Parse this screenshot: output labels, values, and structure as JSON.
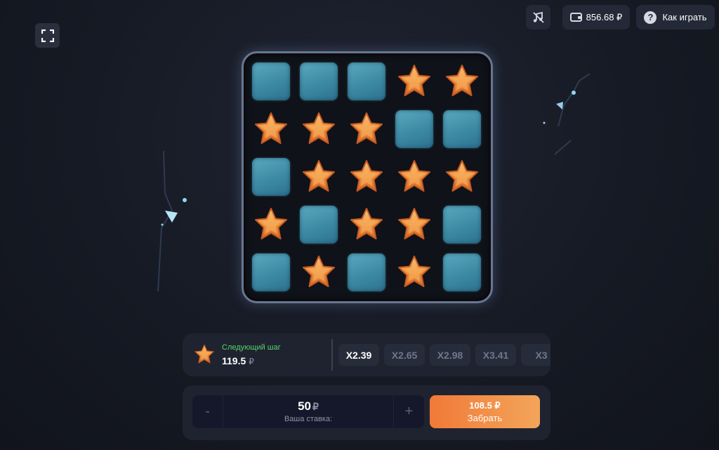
{
  "header": {
    "balance": "856.68 ₽",
    "help_label": "Как играть"
  },
  "board": {
    "rows": 5,
    "cols": 5,
    "cells": [
      [
        "closed",
        "closed",
        "closed",
        "star",
        "star"
      ],
      [
        "star",
        "star",
        "star",
        "closed",
        "closed"
      ],
      [
        "closed",
        "star",
        "star",
        "star",
        "star"
      ],
      [
        "star",
        "closed",
        "star",
        "star",
        "closed"
      ],
      [
        "closed",
        "star",
        "closed",
        "star",
        "closed"
      ]
    ]
  },
  "next_step": {
    "label": "Следующий шаг",
    "value": "119.5",
    "currency": "₽"
  },
  "multipliers": [
    {
      "label": "X2.39",
      "active": true
    },
    {
      "label": "X2.65",
      "active": false
    },
    {
      "label": "X2.98",
      "active": false
    },
    {
      "label": "X3.41",
      "active": false
    },
    {
      "label": "X3",
      "active": false
    }
  ],
  "bet": {
    "amount": "50",
    "currency": "₽",
    "label": "Ваша ставка:",
    "minus": "-",
    "plus": "+"
  },
  "cashout": {
    "amount": "108.5 ₽",
    "label": "Забрать"
  },
  "colors": {
    "background": "#161a24",
    "tile": "#3d8aa5",
    "star": "#f0913d",
    "next_label": "#58d26a",
    "cashout_start": "#f07a37",
    "cashout_end": "#f3a55a"
  }
}
